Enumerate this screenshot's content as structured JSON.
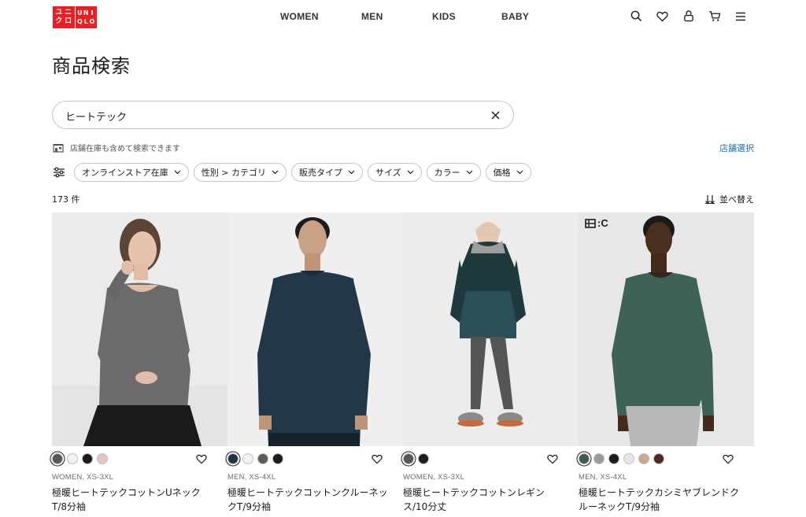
{
  "header": {
    "logo": {
      "line1": [
        "ユ",
        "ニ",
        "ク",
        "ロ"
      ],
      "line2": [
        "U",
        "N",
        "I",
        "Q",
        "L",
        "O"
      ]
    },
    "nav": [
      "WOMEN",
      "MEN",
      "KIDS",
      "BABY"
    ],
    "icons": [
      "search-icon",
      "heart-icon",
      "user-icon",
      "cart-icon",
      "menu-icon"
    ]
  },
  "page": {
    "title": "商品検索"
  },
  "search": {
    "value": "ヒートテック"
  },
  "store": {
    "note": "店舗在庫も含めて検索できます",
    "select_label": "店舗選択"
  },
  "filters": [
    "オンラインストア在庫",
    "性別 > カテゴリ",
    "販売タイプ",
    "サイズ",
    "カラー",
    "価格"
  ],
  "results": {
    "count": "173 件",
    "sort_label": "並べ替え"
  },
  "products": [
    {
      "meta": "WOMEN, XS-3XL",
      "name": "極暖ヒートテックコットンUネックT/8分袖",
      "swatches": [
        "#575757",
        "#f2f2f0",
        "#1c1c1c",
        "#e2c7c5"
      ],
      "bg": "#e9e9e9"
    },
    {
      "meta": "MEN, XS-4XL",
      "name": "極暖ヒートテックコットンクルーネックT/9分袖",
      "swatches": [
        "#1f3447",
        "#f2f2f0",
        "#5c5c5c",
        "#1c1c1c"
      ],
      "bg": "#efefef"
    },
    {
      "meta": "WOMEN, XS-3XL",
      "name": "極暖ヒートテックコットンレギンス/10分丈",
      "swatches": [
        "#575757",
        "#1c1c1c"
      ],
      "bg": "#ececec"
    },
    {
      "meta": "MEN, XS-4XL",
      "name": "極暖ヒートテックカシミヤブレンドクルーネックT/9分袖",
      "swatches": [
        "#3e5a52",
        "#9a9a9a",
        "#1c1c1c",
        "#e6e6e4",
        "#c9a88f",
        "#4a2b22"
      ],
      "bg": "#e7e7e7",
      "badge": ":C"
    }
  ]
}
